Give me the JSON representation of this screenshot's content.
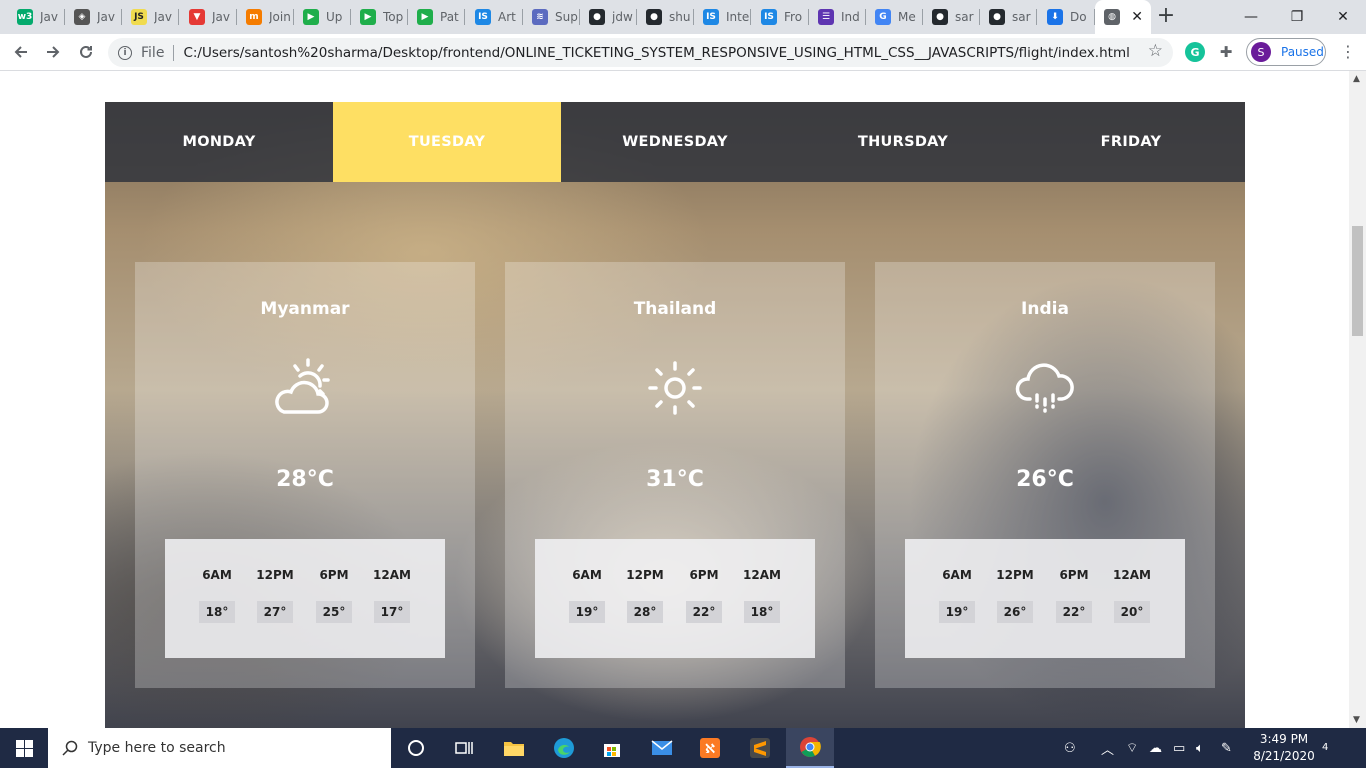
{
  "browser": {
    "tabs": [
      {
        "title": "Jav",
        "favicon": "w3schools-icon",
        "color": "#04aa6d",
        "glyph": "w3"
      },
      {
        "title": "Jav",
        "favicon": "diamond-icon",
        "color": "#555555",
        "glyph": "◈"
      },
      {
        "title": "Jav",
        "favicon": "js-icon",
        "color": "#f0db4f",
        "glyph": "JS"
      },
      {
        "title": "Jav",
        "favicon": "v-icon",
        "color": "#e53935",
        "glyph": "▼"
      },
      {
        "title": "Join",
        "favicon": "tm-icon",
        "color": "#f57c00",
        "glyph": "m"
      },
      {
        "title": "Up",
        "favicon": "play-green-icon",
        "color": "#1fae4b",
        "glyph": "▶"
      },
      {
        "title": "Top",
        "favicon": "play-green-icon",
        "color": "#1fae4b",
        "glyph": "▶"
      },
      {
        "title": "Pat",
        "favicon": "play-green-icon",
        "color": "#1fae4b",
        "glyph": "▶"
      },
      {
        "title": "Art",
        "favicon": "is-icon",
        "color": "#1e88e5",
        "glyph": "IS"
      },
      {
        "title": "Sup",
        "favicon": "wave-icon",
        "color": "#5c6bc0",
        "glyph": "≋"
      },
      {
        "title": "jdw",
        "favicon": "github-icon",
        "color": "#24292e",
        "glyph": "●"
      },
      {
        "title": "shu",
        "favicon": "github-icon",
        "color": "#24292e",
        "glyph": "●"
      },
      {
        "title": "Inte",
        "favicon": "is-icon",
        "color": "#1e88e5",
        "glyph": "IS"
      },
      {
        "title": "Fro",
        "favicon": "is-icon",
        "color": "#1e88e5",
        "glyph": "IS"
      },
      {
        "title": "Ind",
        "favicon": "list-icon",
        "color": "#5e35b1",
        "glyph": "☰"
      },
      {
        "title": "Me",
        "favicon": "google-icon",
        "color": "#4285f4",
        "glyph": "G"
      },
      {
        "title": "sar",
        "favicon": "github-icon",
        "color": "#24292e",
        "glyph": "●"
      },
      {
        "title": "sar",
        "favicon": "github-icon",
        "color": "#24292e",
        "glyph": "●"
      },
      {
        "title": "Do",
        "favicon": "download-icon",
        "color": "#1a73e8",
        "glyph": "⬇"
      },
      {
        "title": "",
        "favicon": "globe-icon",
        "color": "#5f6368",
        "glyph": "◍",
        "active": true
      }
    ],
    "newtab_glyph": "+",
    "window_controls": {
      "minimize": "—",
      "restore": "❐",
      "close": "✕"
    },
    "address": {
      "scheme_label": "File",
      "url": "C:/Users/santosh%20sharma/Desktop/frontend/ONLINE_TICKETING_SYSTEM_RESPONSIVE_USING_HTML_CSS__JAVASCRIPTS/flight/index.html"
    },
    "profile": {
      "initial": "S",
      "status": "Paused"
    }
  },
  "page": {
    "days": [
      {
        "label": "MONDAY",
        "active": false
      },
      {
        "label": "TUESDAY",
        "active": true
      },
      {
        "label": "WEDNESDAY",
        "active": false
      },
      {
        "label": "THURSDAY",
        "active": false
      },
      {
        "label": "FRIDAY",
        "active": false
      }
    ],
    "accent_color": "#fedf63",
    "cards": [
      {
        "city": "Myanmar",
        "icon": "partly-cloudy-icon",
        "temp": "28°C",
        "times": [
          "6AM",
          "12PM",
          "6PM",
          "12AM"
        ],
        "temps": [
          "18°",
          "27°",
          "25°",
          "17°"
        ]
      },
      {
        "city": "Thailand",
        "icon": "sun-icon",
        "temp": "31°C",
        "times": [
          "6AM",
          "12PM",
          "6PM",
          "12AM"
        ],
        "temps": [
          "19°",
          "28°",
          "22°",
          "18°"
        ]
      },
      {
        "city": "India",
        "icon": "rain-cloud-icon",
        "temp": "26°C",
        "times": [
          "6AM",
          "12PM",
          "6PM",
          "12AM"
        ],
        "temps": [
          "19°",
          "26°",
          "22°",
          "20°"
        ]
      }
    ]
  },
  "taskbar": {
    "search_placeholder": "Type here to search",
    "apps": [
      "cortana-icon",
      "task-view-icon",
      "file-explorer-icon",
      "edge-icon",
      "store-icon",
      "mail-icon",
      "xampp-icon",
      "sublime-icon",
      "chrome-icon"
    ],
    "time": "3:49 PM",
    "date": "8/21/2020",
    "notification_count": "4"
  }
}
